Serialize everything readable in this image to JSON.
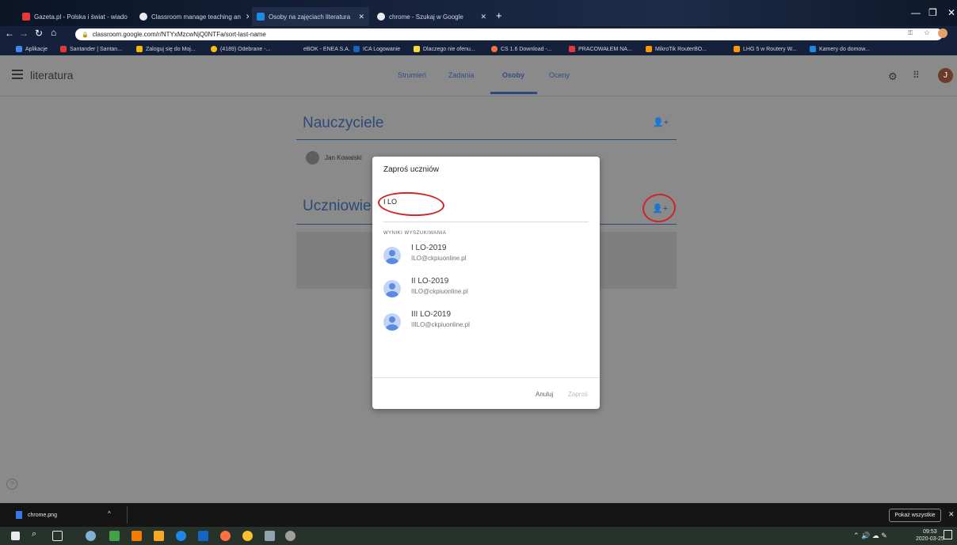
{
  "browser": {
    "tabs": [
      {
        "title": "Gazeta.pl - Polska i świat - wiado",
        "favicon_color": "#e53935"
      },
      {
        "title": "Classroom manage teaching an",
        "favicon_color": "#e8eaed"
      },
      {
        "title": "Osoby na zajęciach literatura",
        "favicon_color": "#1e88e5"
      },
      {
        "title": "chrome - Szukaj w Google",
        "favicon_color": "#e8eaed"
      }
    ],
    "new_tab": "+",
    "url": "classroom.google.com/r/NTYxMzcwNjQ0NTFa/sort-last-name",
    "bookmarks": [
      {
        "label": "Aplikacje",
        "color": "#4285f4"
      },
      {
        "label": "Santander | Santan...",
        "color": "#e53935"
      },
      {
        "label": "Zaloguj się do Moj...",
        "color": "#f4b400"
      },
      {
        "label": "(4189) Odebrane -...",
        "color": "#fbbc05"
      },
      {
        "label": "eBOK - ENEA S.A.",
        "color": "#9e9e9e"
      },
      {
        "label": "ICA Logowanie",
        "color": "#1565c0"
      },
      {
        "label": "Dlaczego nie ofenu...",
        "color": "#fdd835"
      },
      {
        "label": "CS 1.6 Download -...",
        "color": "#ff7043"
      },
      {
        "label": "PRACOWAŁEM NA...",
        "color": "#e53935"
      },
      {
        "label": "MikroTik RouterBO...",
        "color": "#ff9800"
      },
      {
        "label": "LHG 5 w Routery W...",
        "color": "#ff9800"
      },
      {
        "label": "Kamery do domow...",
        "color": "#1e88e5"
      }
    ]
  },
  "classroom": {
    "class_name": "literatura",
    "nav_tabs": [
      {
        "label": "Strumień"
      },
      {
        "label": "Zadania"
      },
      {
        "label": "Osoby"
      },
      {
        "label": "Oceny"
      }
    ],
    "active_tab": "Osoby",
    "avatar_letter": "J",
    "teachers_heading": "Nauczyciele",
    "teacher_name": "Jan Kowalski",
    "students_heading": "Uczniowie",
    "help_glyph": "?"
  },
  "dialog": {
    "title": "Zaproś uczniów",
    "input_value": "I LO",
    "results_heading": "WYNIKI WYSZUKIWANIA",
    "results": [
      {
        "name": "I LO-2019",
        "email": "ILO@ckpiuonline.pl"
      },
      {
        "name": "II LO-2019",
        "email": "IILO@ckpiuonline.pl"
      },
      {
        "name": "III LO-2019",
        "email": "IIILO@ckpiuonline.pl"
      }
    ],
    "cancel_label": "Anuluj",
    "invite_label": "Zaproś"
  },
  "downloads": {
    "file_name": "chrome.png",
    "show_all_label": "Pokaż wszystkie"
  },
  "taskbar": {
    "time": "09:53",
    "date": "2020-03-25"
  },
  "colors": {
    "accent": "#2b4a7a",
    "annotation_red": "#d0242b"
  }
}
